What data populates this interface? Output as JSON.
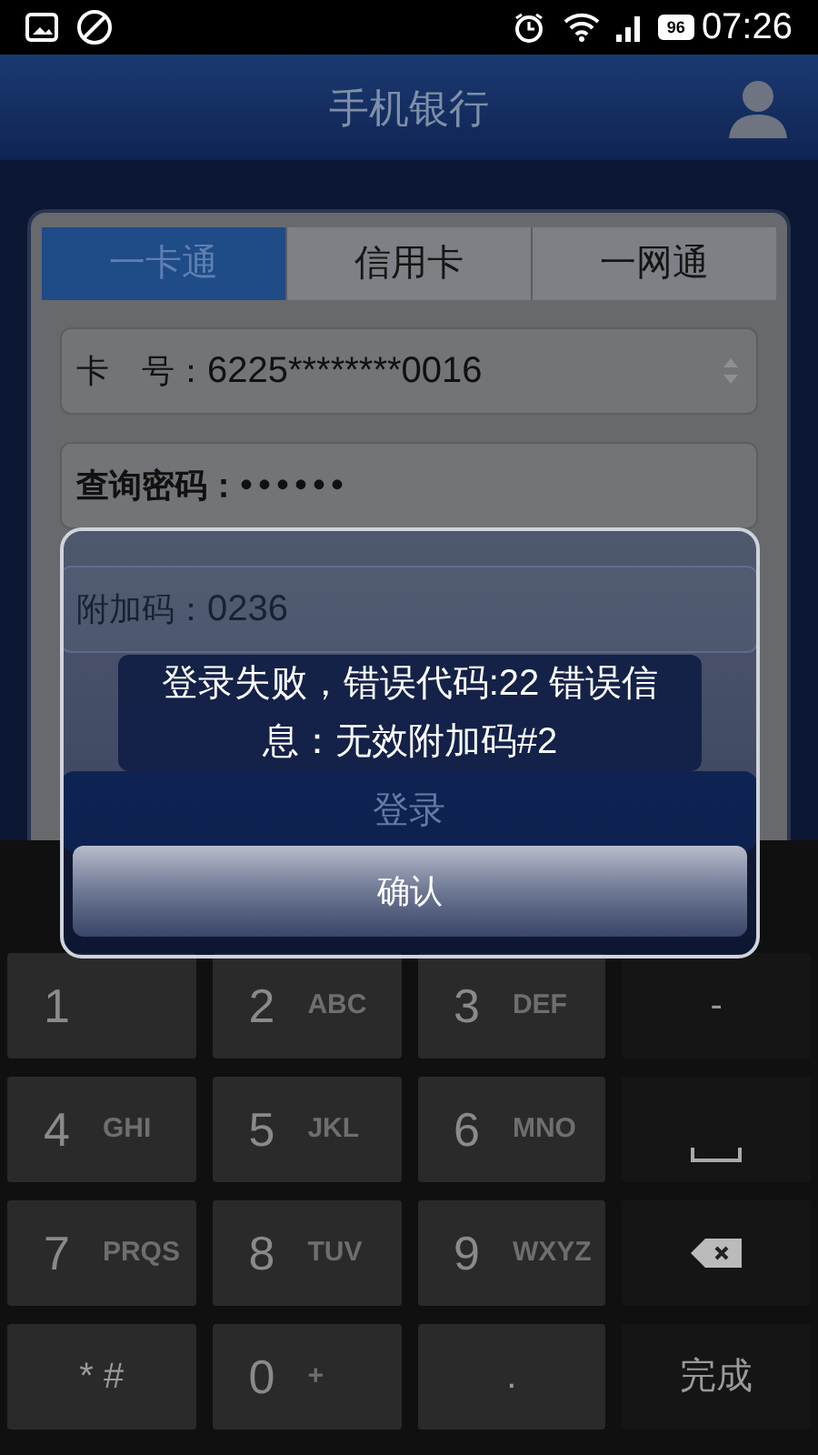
{
  "status_bar": {
    "battery": "96",
    "time": "07:26"
  },
  "header": {
    "title": "手机银行"
  },
  "tabs": [
    {
      "label": "一卡通",
      "selected": true
    },
    {
      "label": "信用卡",
      "selected": false
    },
    {
      "label": "一网通",
      "selected": false
    }
  ],
  "fields": [
    {
      "kind": "select",
      "label": "卡　号：",
      "value": "6225********0016"
    },
    {
      "kind": "password",
      "label": "查询密码：",
      "value": "••••••"
    },
    {
      "kind": "text",
      "label": "附加码：",
      "value": "0236"
    }
  ],
  "login_button": "登录",
  "dialog": {
    "message": "登录失败，错误代码:22 错误信息：无效附加码#2",
    "button": "确认"
  },
  "keyboard": [
    {
      "kind": "digit",
      "main": "1"
    },
    {
      "kind": "digit",
      "main": "2",
      "sub": "ABC"
    },
    {
      "kind": "digit",
      "main": "3",
      "sub": "DEF"
    },
    {
      "kind": "fn",
      "main": "-"
    },
    {
      "kind": "digit",
      "main": "4",
      "sub": "GHI"
    },
    {
      "kind": "digit",
      "main": "5",
      "sub": "JKL"
    },
    {
      "kind": "digit",
      "main": "6",
      "sub": "MNO"
    },
    {
      "kind": "space"
    },
    {
      "kind": "digit",
      "main": "7",
      "sub": "PRQS"
    },
    {
      "kind": "digit",
      "main": "8",
      "sub": "TUV"
    },
    {
      "kind": "digit",
      "main": "9",
      "sub": "WXYZ"
    },
    {
      "kind": "backspace"
    },
    {
      "kind": "center",
      "main": "* #"
    },
    {
      "kind": "digit",
      "main": "0",
      "sub": "+"
    },
    {
      "kind": "center",
      "main": "."
    },
    {
      "kind": "fn",
      "main": "完成"
    }
  ]
}
